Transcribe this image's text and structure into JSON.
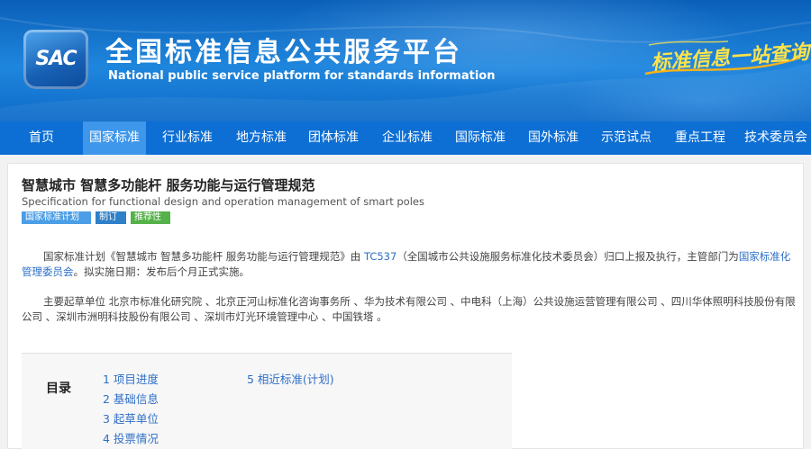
{
  "header": {
    "logo_text": "SAC",
    "site_title": "全国标准信息公共服务平台",
    "site_subtitle": "National public service platform  for standards information",
    "slogan": "标准信息一站查询"
  },
  "nav": {
    "items": [
      "首页",
      "国家标准",
      "行业标准",
      "地方标准",
      "团体标准",
      "企业标准",
      "国际标准",
      "国外标准",
      "示范试点",
      "重点工程",
      "技术委员会"
    ],
    "active_index": 1
  },
  "standard": {
    "title_cn": "智慧城市 智慧多功能杆 服务功能与运行管理规范",
    "title_en": "Specification for functional design and operation management of smart poles",
    "tags": [
      "国家标准计划",
      "制订",
      "推荐性"
    ],
    "paragraph1": {
      "seg1": "国家标准计划《智慧城市 智慧多功能杆 服务功能与运行管理规范》由 ",
      "link1": "TC537",
      "seg2": "（全国城市公共设施服务标准化技术委员会）归口上报及执行，主管部门为",
      "link2": "国家标准化管理委员会",
      "seg3": "。拟实施日期：发布后个月正式实施。"
    },
    "paragraph2": "主要起草单位 北京市标准化研究院 、北京正河山标准化咨询事务所 、华为技术有限公司 、中电科（上海）公共设施运营管理有限公司 、四川华体照明科技股份有限公司 、深圳市洲明科技股份有限公司 、深圳市灯光环境管理中心 、中国铁塔 。"
  },
  "toc": {
    "label": "目录",
    "items": [
      "1  项目进度",
      "2  基础信息",
      "3  起草单位",
      "4  投票情况",
      "5  相近标准(计划)"
    ]
  },
  "colors": {
    "header_blue": "#1f86dd",
    "nav_blue": "#0d6fd4",
    "nav_active": "#3e97ea",
    "link": "#2e6fc7",
    "tag_plan": "#4b9ee6",
    "tag_revise": "#2f80c8",
    "tag_recommend": "#55b24a",
    "slogan_yellow": "#fde34a"
  }
}
